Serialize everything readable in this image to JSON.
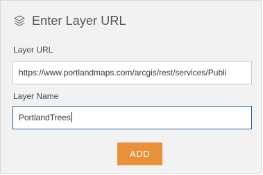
{
  "header": {
    "icon": "layers-icon",
    "title": "Enter Layer URL"
  },
  "form": {
    "layer_url_label": "Layer URL",
    "layer_url_value": "https://www.portlandmaps.com/arcgis/rest/services/Publi",
    "layer_name_label": "Layer Name",
    "layer_name_value": "PortlandTrees"
  },
  "actions": {
    "add_label": "ADD"
  },
  "colors": {
    "accent": "#e8913a",
    "focus_border": "#2a5a8c",
    "panel_bg": "#f2f2f2"
  }
}
